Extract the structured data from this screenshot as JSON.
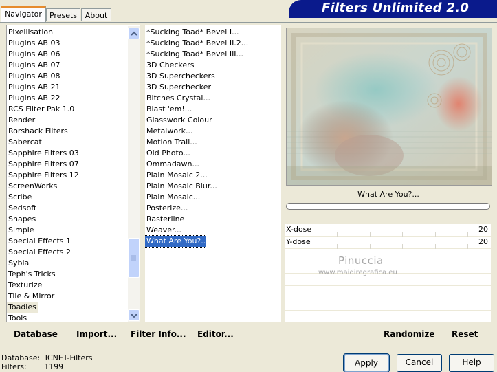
{
  "tabs": [
    {
      "label": "Navigator",
      "active": true
    },
    {
      "label": "Presets",
      "active": false
    },
    {
      "label": "About",
      "active": false
    }
  ],
  "app_title": "Filters Unlimited 2.0",
  "categories": [
    "Pixellisation",
    "Plugins AB 03",
    "Plugins AB 06",
    "Plugins AB 07",
    "Plugins AB 08",
    "Plugins AB 21",
    "Plugins AB 22",
    "RCS Filter Pak 1.0",
    "Render",
    "Rorshack Filters",
    "Sabercat",
    "Sapphire Filters 03",
    "Sapphire Filters 07",
    "Sapphire Filters 12",
    "ScreenWorks",
    "Scribe",
    "Sedsoft",
    "Shapes",
    "Simple",
    "Special Effects 1",
    "Special Effects 2",
    "Sybia",
    "Teph's Tricks",
    "Texturize",
    "Tile & Mirror",
    "Toadies",
    "Tools"
  ],
  "selected_category": "Toadies",
  "filters": [
    "*Sucking Toad*  Bevel I...",
    "*Sucking Toad*  Bevel II.2...",
    "*Sucking Toad*  Bevel III...",
    "3D Checkers",
    "3D Supercheckers",
    "3D Superchecker",
    "Bitches Crystal...",
    "Blast 'em!...",
    "Glasswork Colour",
    "Metalwork...",
    "Motion Trail...",
    "Old Photo...",
    "Ommadawn...",
    "Plain Mosaic 2...",
    "Plain Mosaic Blur...",
    "Plain Mosaic...",
    "Posterize...",
    "Rasterline",
    "Weaver...",
    "What Are You?..."
  ],
  "selected_filter": "What Are You?...",
  "preview": {
    "filter_name": "What Are You?..."
  },
  "params": [
    {
      "label": "X-dose",
      "value": "20"
    },
    {
      "label": "Y-dose",
      "value": "20"
    }
  ],
  "watermark": {
    "line1": "Pinuccia",
    "line2": "www.maidiregrafica.eu"
  },
  "toolbar": {
    "database": "Database",
    "import": "Import...",
    "filter_info": "Filter Info...",
    "editor": "Editor...",
    "randomize": "Randomize",
    "reset": "Reset"
  },
  "status": {
    "database_label": "Database:",
    "database_value": "ICNET-Filters",
    "filters_label": "Filters:",
    "filters_value": "1199"
  },
  "buttons": {
    "apply": "Apply",
    "cancel": "Cancel",
    "help": "Help"
  },
  "colors": {
    "banner": "#0a1a8c",
    "selection": "#316ac5"
  }
}
